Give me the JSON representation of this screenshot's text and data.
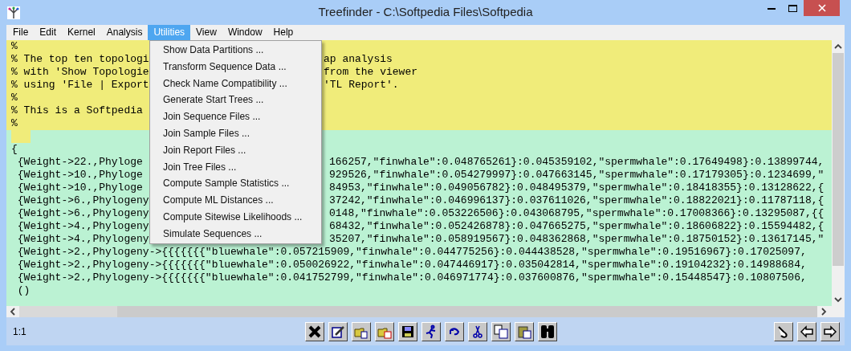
{
  "window": {
    "title": "Treefinder - C:\\Softpedia Files\\Softpedia"
  },
  "menu_bar": [
    {
      "label": "File",
      "selected": false
    },
    {
      "label": "Edit",
      "selected": false
    },
    {
      "label": "Kernel",
      "selected": false
    },
    {
      "label": "Analysis",
      "selected": false
    },
    {
      "label": "Utilities",
      "selected": true
    },
    {
      "label": "View",
      "selected": false
    },
    {
      "label": "Window",
      "selected": false
    },
    {
      "label": "Help",
      "selected": false
    }
  ],
  "utilities_menu": [
    "Show Data Partitions ...",
    "Transform Sequence Data ...",
    "Check Name Compatibility ...",
    "Generate Start Trees ...",
    "Join Sequence Files ...",
    "Join Sample Files ...",
    "Join Report Files ...",
    "Join Tree Files ...",
    "Compute Sample Statistics ...",
    "Compute ML Distances ...",
    "Compute Sitewise Likelihoods ...",
    "Simulate Sequences ..."
  ],
  "comment_lines": [
    {
      "left": "%"
    },
    {
      "left": "% The top ten topologi",
      "right": "ap analysis"
    },
    {
      "left": "% with 'Show Topologie",
      "right": "from the viewer"
    },
    {
      "left": "% using 'File | Export",
      "right": "'TL Report'."
    },
    {
      "left": "%"
    },
    {
      "left": "% This is a Softpedia"
    },
    {
      "left": "%"
    }
  ],
  "data_lines": [
    {
      "left": "{"
    },
    {
      "left": " {Weight->22.,Phyloge",
      "right": "166257,\"finwhale\":0.048765261}:0.045359102,\"spermwhale\":0.17649498}:0.13899744,"
    },
    {
      "left": " {Weight->10.,Phyloge",
      "right": "929526,\"finwhale\":0.054279997}:0.047663145,\"spermwhale\":0.17179305}:0.1234699,\""
    },
    {
      "left": " {Weight->10.,Phyloge",
      "right": "84953,\"finwhale\":0.049056782}:0.048495379,\"spermwhale\":0.18418355}:0.13128622,{"
    },
    {
      "left": " {Weight->6.,Phylogeny",
      "right": "37242,\"finwhale\":0.046996137}:0.037611026,\"spermwhale\":0.18822021}:0.11787118,{"
    },
    {
      "left": " {Weight->6.,Phylogeny",
      "right": "0148,\"finwhale\":0.053226506}:0.043068795,\"spermwhale\":0.17008366}:0.13295087,{{"
    },
    {
      "left": " {Weight->4.,Phylogeny",
      "right": "68432,\"finwhale\":0.052426878}:0.047665275,\"spermwhale\":0.18606822}:0.15594482,{"
    },
    {
      "left": " {Weight->4.,Phylogeny",
      "right": "35207,\"finwhale\":0.058919567}:0.048362868,\"spermwhale\":0.18750152}:0.13617145,\""
    },
    {
      "left": " {Weight->2.,Phylogeny->{{{{{{{\"bluewhale\":0.057215909,\"finwhale\":0.044775256}:0.044438528,\"spermwhale\":0.19516967}:0.17025097,"
    },
    {
      "left": " {Weight->2.,Phylogeny->{{{{{{{\"bluewhale\":0.050026922,\"finwhale\":0.047446917}:0.035042814,\"spermwhale\":0.19104232}:0.14988684,"
    },
    {
      "left": " {Weight->2.,Phylogeny->{{{{{{{\"bluewhale\":0.041752799,\"finwhale\":0.046971774}:0.037600876,\"spermwhale\":0.15448547}:0.10807506,"
    },
    {
      "left": " ()"
    }
  ],
  "status_bar": {
    "position": "1:1"
  }
}
